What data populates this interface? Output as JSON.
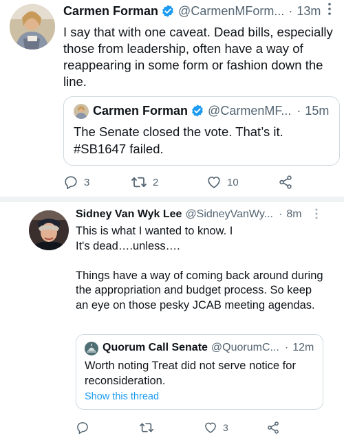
{
  "tweet1": {
    "author_name": "Carmen Forman",
    "handle": "@CarmenMForm...",
    "separator": "·",
    "time": "13m",
    "text": "I say that with one caveat. Dead bills, especially those from leadership, often have a way of reappearing in some form or fashion down the line.",
    "quote": {
      "author_name": "Carmen Forman",
      "handle": "@CarmenMF...",
      "separator": "·",
      "time": "15m",
      "text": "The Senate closed the vote. That’s it. #SB1647 failed."
    },
    "actions": {
      "reply_count": "3",
      "retweet_count": "2",
      "like_count": "10"
    }
  },
  "tweet2": {
    "author_name": "Sidney Van Wyk Lee",
    "handle": "@SidneyVanWy...",
    "separator": "·",
    "time": "8m",
    "text": "This is what I wanted to know. I\nIt's dead….unless….\n\nThings have a way of coming back around during the appropriation and budget process. So keep an eye on those pesky JCAB meeting agendas.",
    "quote": {
      "author_name": "Quorum Call Senate",
      "handle": "@QuorumC...",
      "separator": "·",
      "time": "12m",
      "text": "Worth noting Treat did not serve notice for reconsideration.",
      "show_thread": "Show this thread"
    },
    "actions": {
      "reply_count": "",
      "retweet_count": "",
      "like_count": "3"
    }
  },
  "colors": {
    "text": "#0f1419",
    "secondary": "#536471",
    "verified": "#1d9bf0",
    "link": "#1d9bf0",
    "border": "#cfd9de",
    "divider": "#eff3f4"
  },
  "icons": [
    "verified-badge-icon",
    "more-icon",
    "reply-icon",
    "retweet-icon",
    "like-icon",
    "share-icon"
  ]
}
